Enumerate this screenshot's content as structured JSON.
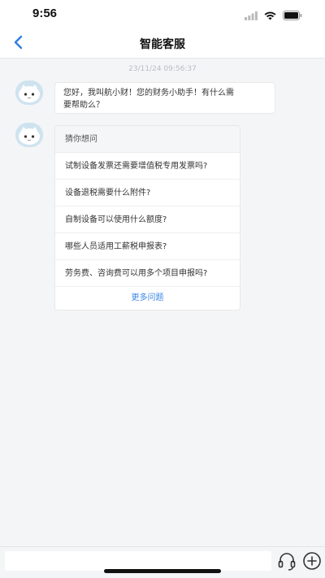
{
  "status_bar": {
    "time": "9:56"
  },
  "nav": {
    "title": "智能客服"
  },
  "chat": {
    "timestamp": "23/11/24 09:56:37",
    "greeting_line1": "您好，我叫航小财！您的财务小助手！有什么需",
    "greeting_line2": "要帮助么？",
    "faq": {
      "header": "猜你想问",
      "items": [
        "试制设备发票还需要增值税专用发票吗?",
        "设备退税需要什么附件?",
        "自制设备可以使用什么额度?",
        "哪些人员适用工薪税申报表?",
        "劳务费、咨询费可以用多个项目申报吗?"
      ],
      "more": "更多问题"
    }
  },
  "input": {
    "placeholder": ""
  },
  "icons": {
    "back": "chevron-left-icon",
    "avatar": "robot-avatar-icon",
    "headset": "headset-icon",
    "plus": "plus-circle-icon"
  },
  "colors": {
    "accent": "#3a88e6",
    "background": "#f4f5f7"
  }
}
